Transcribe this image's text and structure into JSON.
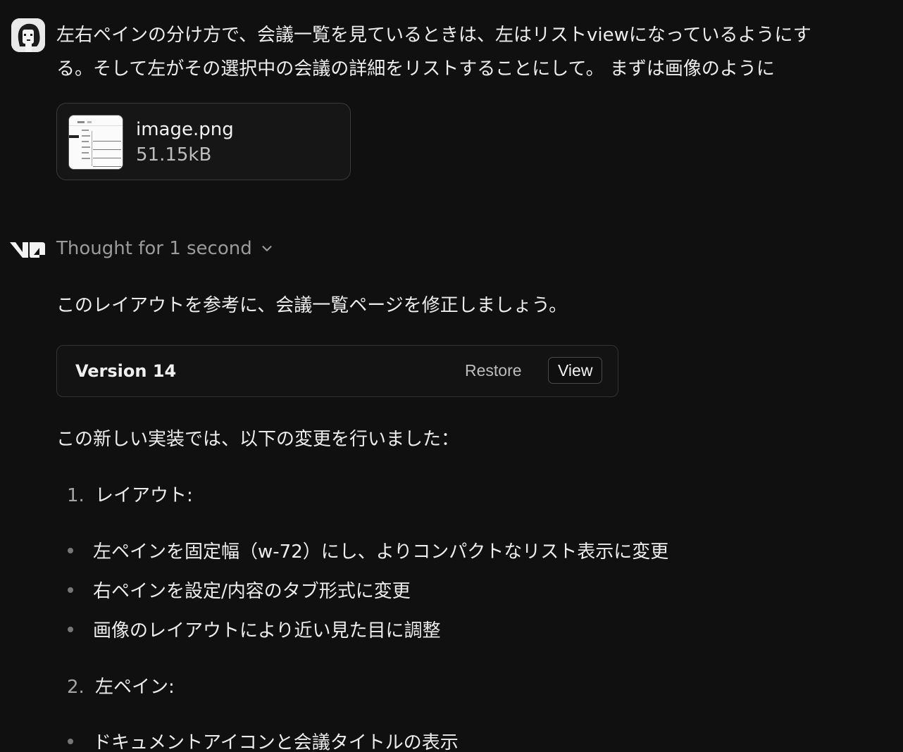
{
  "user_message": {
    "line1": "左右ペインの分け方で、会議一覧を見ているときは、左はリストviewになっているようにす",
    "line2": "る。そして左がその選択中の会議の詳細をリストすることにして。 まずは画像のように",
    "attachment": {
      "name": "image.png",
      "size": "51.15kB"
    }
  },
  "assistant": {
    "thought_label": "Thought for 1 second",
    "intro": "このレイアウトを参考に、会議一覧ページを修正しましょう。",
    "version_card": {
      "title": "Version 14",
      "restore_label": "Restore",
      "view_label": "View"
    },
    "changes_intro": "この新しい実装では、以下の変更を行いました：",
    "sections": [
      {
        "number": "1.",
        "title": "レイアウト:",
        "bullets": [
          "左ペインを固定幅（w-72）にし、よりコンパクトなリスト表示に変更",
          "右ペインを設定/内容のタブ形式に変更",
          "画像のレイアウトにより近い見た目に調整"
        ]
      },
      {
        "number": "2.",
        "title": "左ペイン:",
        "bullets": [
          "ドキュメントアイコンと会議タイトルの表示"
        ]
      }
    ]
  },
  "icons": {
    "avatar": "pixel-art-avatar",
    "assistant_logo": "v0-logo-icon",
    "thought_toggle": "chevron-down-icon",
    "attachment_thumbnail": "image-thumbnail"
  }
}
